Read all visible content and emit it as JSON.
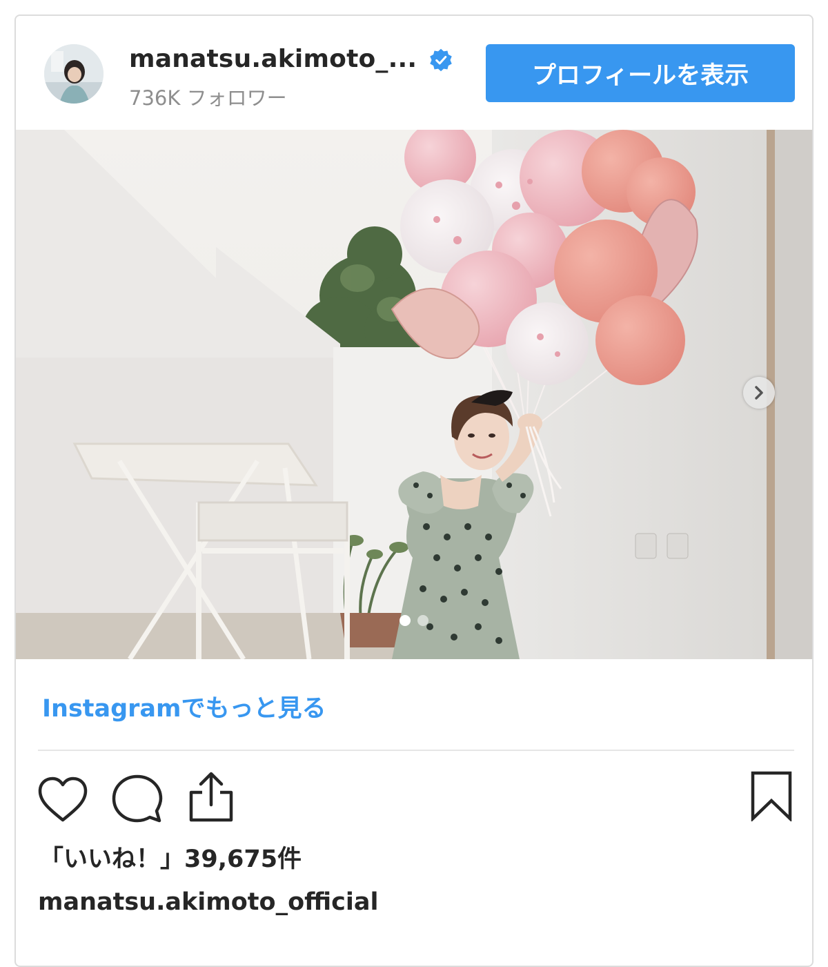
{
  "header": {
    "username": "manatsu.akimoto_...",
    "followers": "736K フォロワー",
    "profile_button_label": "プロフィールを表示",
    "verified_icon": "verified-badge-icon"
  },
  "carousel": {
    "current_index": 1,
    "total": 2,
    "next_icon": "chevron-right-icon"
  },
  "more_link": "Instagramでもっと見る",
  "actions": {
    "like_icon": "heart-icon",
    "comment_icon": "comment-icon",
    "share_icon": "share-icon",
    "save_icon": "bookmark-icon"
  },
  "likes_text": "「いいね！」39,675件",
  "caption_username": "manatsu.akimoto_official",
  "colors": {
    "accent": "#3897f0",
    "text": "#262626",
    "muted": "#8e8e8e"
  }
}
